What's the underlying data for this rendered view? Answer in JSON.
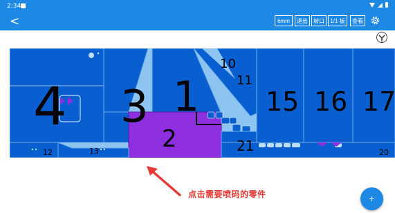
{
  "status": {
    "time": "2:34"
  },
  "toolbar": {
    "back_label": "<",
    "buttons": [
      "6mm",
      "退出",
      "坡口",
      "1/1 板",
      "查看"
    ]
  },
  "parts": {
    "big": [
      "4",
      "3",
      "1",
      "2",
      "15",
      "16",
      "17"
    ],
    "small": [
      "10",
      "11",
      "12",
      "13",
      "21",
      "20"
    ]
  },
  "hint_text": "点击需要喷码的零件",
  "fab_label": "+",
  "colors": {
    "brand": "#1e88e5",
    "part": "#0a5fd0",
    "selected": "#8e2fe0",
    "hint": "#e53935"
  }
}
